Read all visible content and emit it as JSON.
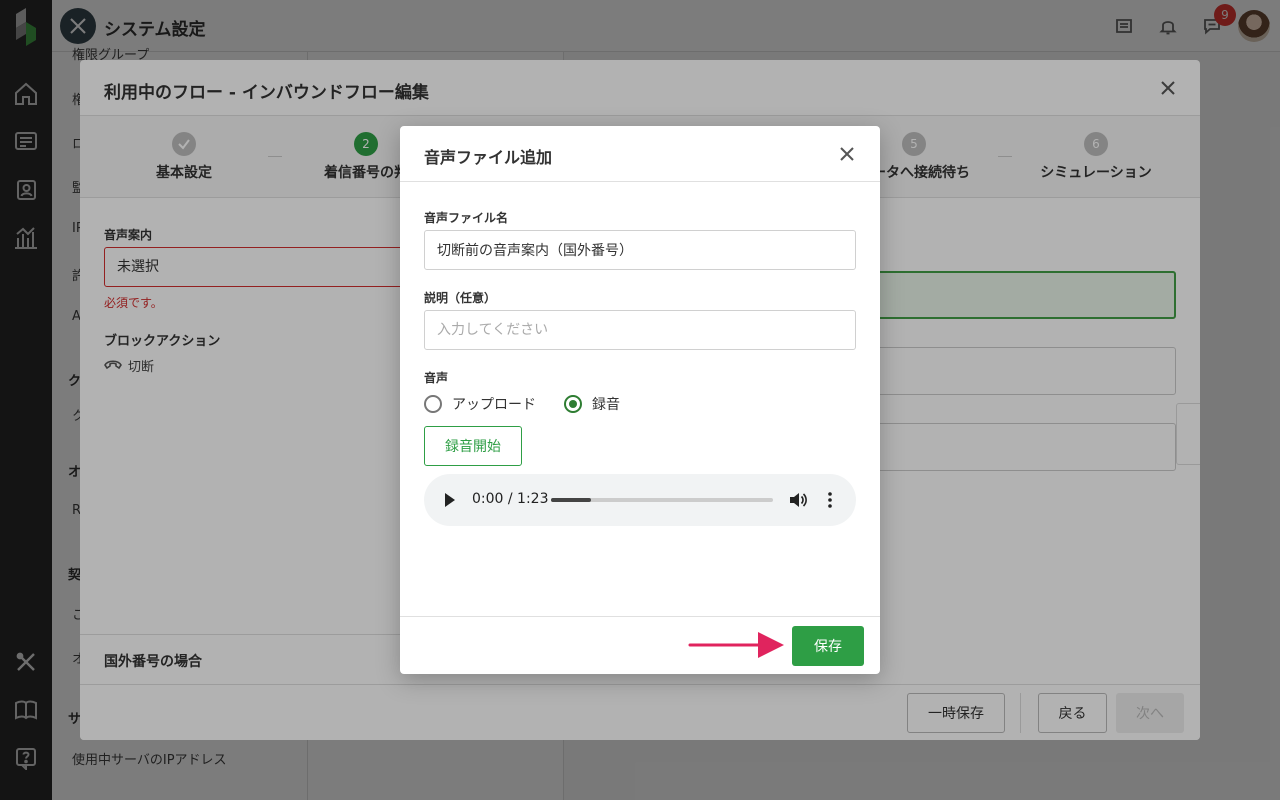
{
  "topbar": {
    "app_title": "システム設定",
    "notification_count": "9"
  },
  "background": {
    "sidebar_items": [
      "権限グループ",
      "権",
      "ロ",
      "監",
      "IP",
      "許",
      "A",
      "ク",
      "ク",
      "オ",
      "R",
      "契",
      "こ",
      "オ",
      "サ"
    ],
    "sidebar_bottom_item": "使用中サーバのIPアドレス"
  },
  "flow_modal": {
    "title": "利用中のフロー - インバウンドフロー編集",
    "steps": [
      {
        "number": "✓",
        "label": "基本設定"
      },
      {
        "number": "2",
        "label": "着信番号の判"
      },
      {
        "number": "5",
        "label": "レータへ接続待ち"
      },
      {
        "number": "6",
        "label": "シミュレーション"
      }
    ],
    "voice_guide_label": "音声案内",
    "voice_guide_value": "未選択",
    "required_error": "必須です。",
    "block_action_label": "ブロックアクション",
    "block_action_value": "切断",
    "section_title": "国外番号の場合",
    "footer": {
      "temp_save": "一時保存",
      "back": "戻る",
      "next": "次へ"
    }
  },
  "audio_dialog": {
    "title": "音声ファイル追加",
    "file_name_label": "音声ファイル名",
    "file_name_value": "切断前の音声案内（国外番号）",
    "description_label": "説明（任意）",
    "description_placeholder": "入力してください",
    "audio_label": "音声",
    "radio_options": [
      {
        "label": "アップロード",
        "checked": false
      },
      {
        "label": "録音",
        "checked": true
      }
    ],
    "record_start": "録音開始",
    "player": {
      "time": "0:00 / 1:23",
      "progress_fraction": 0.18
    },
    "save": "保存"
  },
  "colors": {
    "primary_green": "#2e9e45",
    "error_red": "#d32f2f",
    "arrow_pink": "#e0245e",
    "rail": "#2b2b2b"
  }
}
